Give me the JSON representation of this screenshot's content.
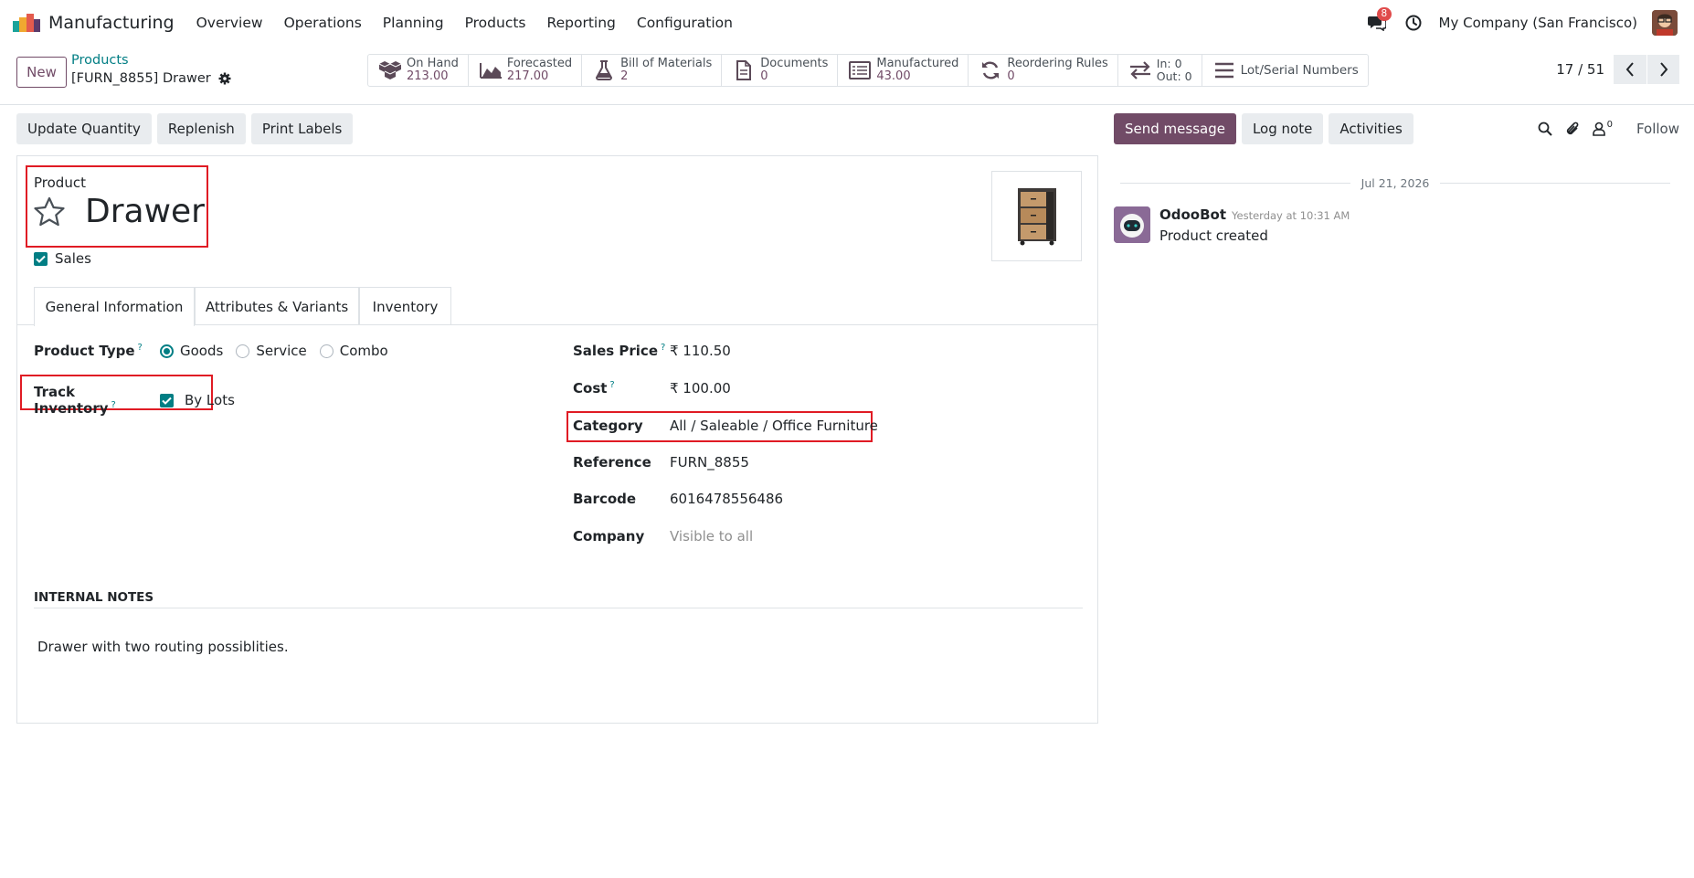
{
  "app": {
    "name": "Manufacturing",
    "menu": [
      "Overview",
      "Operations",
      "Planning",
      "Products",
      "Reporting",
      "Configuration"
    ],
    "messages_badge": "8",
    "company": "My Company (San Francisco)"
  },
  "control": {
    "new_label": "New",
    "breadcrumb_parent": "Products",
    "breadcrumb_current": "[FURN_8855] Drawer",
    "pager": "17 / 51"
  },
  "smart_buttons": {
    "on_hand": {
      "label": "On Hand",
      "value": "213.00",
      "icon": "boxes-icon"
    },
    "forecasted": {
      "label": "Forecasted",
      "value": "217.00",
      "icon": "area-chart-icon"
    },
    "bom": {
      "label": "Bill of Materials",
      "value": "2",
      "icon": "flask-icon"
    },
    "documents": {
      "label": "Documents",
      "value": "0",
      "icon": "file-icon"
    },
    "manufactured": {
      "label": "Manufactured",
      "value": "43.00",
      "icon": "list-alt-icon"
    },
    "reordering": {
      "label": "Reordering Rules",
      "value": "0",
      "icon": "refresh-icon"
    },
    "inout": {
      "in": "In: 0",
      "out": "Out: 0",
      "icon": "exchange-icon"
    },
    "lots": {
      "label": "Lot/Serial Numbers",
      "icon": "bars-icon"
    }
  },
  "actions": {
    "update_quantity": "Update Quantity",
    "replenish": "Replenish",
    "print_labels": "Print Labels"
  },
  "form": {
    "product_label": "Product",
    "name": "Drawer",
    "sales_label": "Sales",
    "tabs": [
      "General Information",
      "Attributes & Variants",
      "Inventory"
    ],
    "product_type_label": "Product Type",
    "product_type_options": [
      "Goods",
      "Service",
      "Combo"
    ],
    "product_type_selected": "Goods",
    "track_inventory_label": "Track Inventory",
    "track_inventory_value": "By Lots",
    "sales_price_label": "Sales Price",
    "sales_price": "₹ 110.50",
    "cost_label": "Cost",
    "cost": "₹ 100.00",
    "category_label": "Category",
    "category": "All / Saleable / Office Furniture",
    "reference_label": "Reference",
    "reference": "FURN_8855",
    "barcode_label": "Barcode",
    "barcode": "6016478556486",
    "company_label": "Company",
    "company_placeholder": "Visible to all",
    "notes_heading": "INTERNAL NOTES",
    "notes": "Drawer with two routing possiblities."
  },
  "chatter": {
    "send_message": "Send message",
    "log_note": "Log note",
    "activities": "Activities",
    "followers_count": "0",
    "follow": "Follow",
    "date": "Jul 21, 2026",
    "message": {
      "author": "OdooBot",
      "time": "Yesterday at 10:31 AM",
      "text": "Product created"
    }
  },
  "colors": {
    "brand": "#714b67",
    "accent": "#017e84",
    "highlight": "#e01b24"
  }
}
